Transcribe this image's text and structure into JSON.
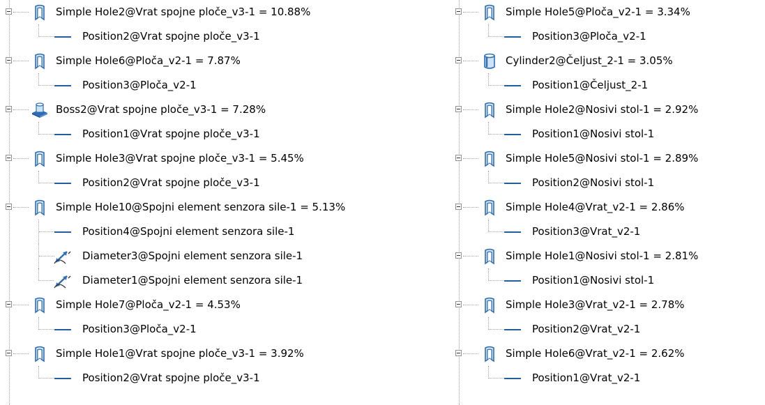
{
  "left_column": [
    {
      "label": "Simple Hole2@Vrat spojne ploče_v3-1 = 10.88%",
      "icon": "simple-hole-icon",
      "children": [
        {
          "type": "position",
          "label": "Position2@Vrat spojne ploče_v3-1"
        }
      ]
    },
    {
      "label": "Simple Hole6@Ploča_v2-1 = 7.87%",
      "icon": "simple-hole-icon",
      "children": [
        {
          "type": "position",
          "label": "Position3@Ploča_v2-1"
        }
      ]
    },
    {
      "label": "Boss2@Vrat spojne ploče_v3-1 = 7.28%",
      "icon": "boss-icon",
      "children": [
        {
          "type": "position",
          "label": "Position1@Vrat spojne ploče_v3-1"
        }
      ]
    },
    {
      "label": "Simple Hole3@Vrat spojne ploče_v3-1 = 5.45%",
      "icon": "simple-hole-icon",
      "children": [
        {
          "type": "position",
          "label": "Position2@Vrat spojne ploče_v3-1"
        }
      ]
    },
    {
      "label": "Simple Hole10@Spojni element senzora sile-1 = 5.13%",
      "icon": "simple-hole-icon",
      "children": [
        {
          "type": "position",
          "label": "Position4@Spojni element senzora sile-1"
        },
        {
          "type": "diameter",
          "label": "Diameter3@Spojni element senzora sile-1"
        },
        {
          "type": "diameter",
          "label": "Diameter1@Spojni element senzora sile-1"
        }
      ]
    },
    {
      "label": "Simple Hole7@Ploča_v2-1 = 4.53%",
      "icon": "simple-hole-icon",
      "children": [
        {
          "type": "position",
          "label": "Position3@Ploča_v2-1"
        }
      ]
    },
    {
      "label": "Simple Hole1@Vrat spojne ploče_v3-1 = 3.92%",
      "icon": "simple-hole-icon",
      "children": [
        {
          "type": "position",
          "label": "Position2@Vrat spojne ploče_v3-1"
        }
      ]
    }
  ],
  "right_column": [
    {
      "label": "Simple Hole5@Ploča_v2-1 = 3.34%",
      "icon": "simple-hole-icon",
      "children": [
        {
          "type": "position",
          "label": "Position3@Ploča_v2-1"
        }
      ]
    },
    {
      "label": "Cylinder2@Čeljust_2-1 = 3.05%",
      "icon": "cylinder-icon",
      "children": [
        {
          "type": "position",
          "label": "Position1@Čeljust_2-1"
        }
      ]
    },
    {
      "label": "Simple Hole2@Nosivi stol-1 = 2.92%",
      "icon": "simple-hole-icon",
      "children": [
        {
          "type": "position",
          "label": "Position1@Nosivi stol-1"
        }
      ]
    },
    {
      "label": "Simple Hole5@Nosivi stol-1 = 2.89%",
      "icon": "simple-hole-icon",
      "children": [
        {
          "type": "position",
          "label": "Position2@Nosivi stol-1"
        }
      ]
    },
    {
      "label": "Simple Hole4@Vrat_v2-1 = 2.86%",
      "icon": "simple-hole-icon",
      "children": [
        {
          "type": "position",
          "label": "Position3@Vrat_v2-1"
        }
      ]
    },
    {
      "label": "Simple Hole1@Nosivi stol-1 = 2.81%",
      "icon": "simple-hole-icon",
      "children": [
        {
          "type": "position",
          "label": "Position1@Nosivi stol-1"
        }
      ]
    },
    {
      "label": "Simple Hole3@Vrat_v2-1 = 2.78%",
      "icon": "simple-hole-icon",
      "children": [
        {
          "type": "position",
          "label": "Position2@Vrat_v2-1"
        }
      ]
    },
    {
      "label": "Simple Hole6@Vrat_v2-1 = 2.62%",
      "icon": "simple-hole-icon",
      "children": [
        {
          "type": "position",
          "label": "Position1@Vrat_v2-1"
        }
      ]
    }
  ],
  "colors": {
    "icon_blue": "#2f6db3",
    "icon_light": "#cfe3f7",
    "position_line": "#1f5f9f",
    "connector": "#a0a0a0"
  }
}
